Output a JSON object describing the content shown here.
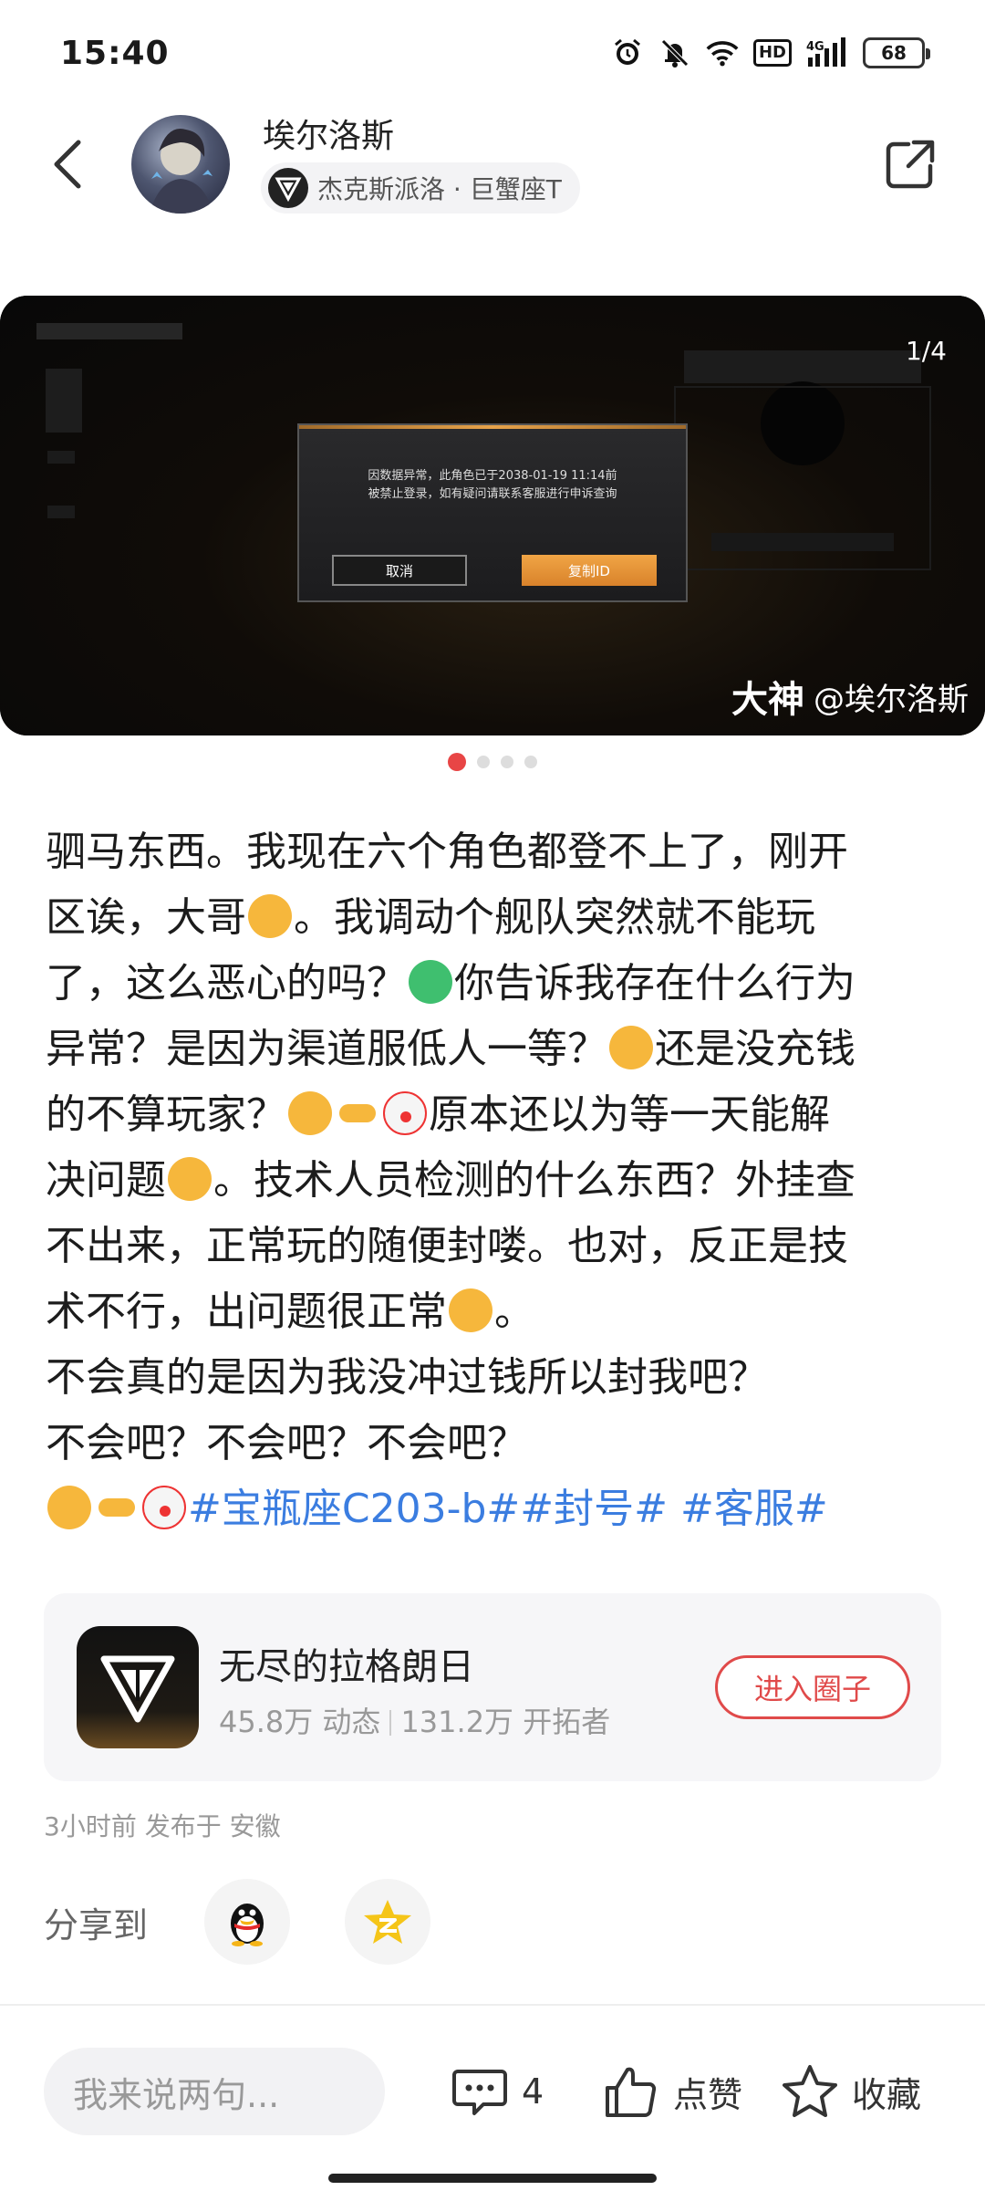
{
  "status_bar": {
    "time": "15:40",
    "network": "4G",
    "hd": "HD",
    "battery": "68",
    "icons": [
      "alarm-icon",
      "mute-icon",
      "wifi-icon",
      "hd-icon",
      "signal-icon",
      "battery-icon"
    ]
  },
  "header": {
    "author": "埃尔洛斯",
    "subtitle": "杰克斯派洛 · 巨蟹座T"
  },
  "gallery": {
    "counter": "1/4",
    "dialog_message_line1": "因数据异常，此角色已于2038-01-19 11:14前",
    "dialog_message_line2": "被禁止登录，如有疑问请联系客服进行申诉查询",
    "cancel_label": "取消",
    "copy_label": "复制ID",
    "watermark_brand": "大神",
    "watermark_handle": "@埃尔洛斯",
    "pages": 4,
    "active_page": 1
  },
  "post": {
    "l1": "驷马东西。我现在六个角色都登不上了，刚开",
    "l2a": "区诶，大哥",
    "l2b": "。我调动个舰队突然就不能玩",
    "l3a": "了，这么恶心的吗？",
    "l3b": "你告诉我存在什么行为",
    "l4a": "异常？是因为渠道服低人一等？",
    "l4b": "还是没充钱",
    "l5a": "的不算玩家？",
    "l5b": "原本还以为等一天能解",
    "l6a": "决问题",
    "l6b": "。技术人员检测的什么东西？外挂查",
    "l7": "不出来，正常玩的随便封喽。也对，反正是技",
    "l8a": "术不行，出问题很正常",
    "l8b": "。",
    "l9": "不会真的是因为我没冲过钱所以封我吧？",
    "l10": "不会吧？不会吧？不会吧？",
    "tags": "#宝瓶座C203-b##封号# #客服#"
  },
  "circle": {
    "name": "无尽的拉格朗日",
    "posts": "45.8万 动态",
    "members": "131.2万 开拓者",
    "enter_label": "进入圈子"
  },
  "meta": "3小时前 发布于 安徽",
  "share": {
    "label": "分享到"
  },
  "bottom_bar": {
    "comment_placeholder": "我来说两句...",
    "comment_count": "4",
    "like_label": "点赞",
    "favorite_label": "收藏"
  }
}
